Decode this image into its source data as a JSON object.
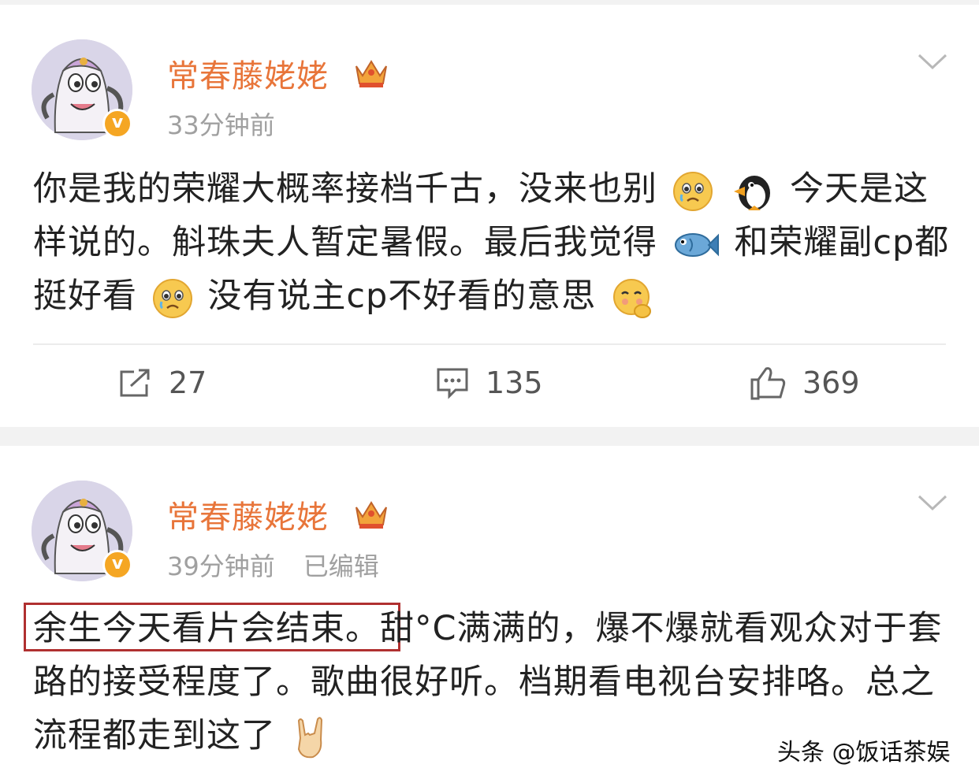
{
  "posts": [
    {
      "username": "常春藤姥姥",
      "time": "33分钟前",
      "edited": "",
      "text": {
        "part1": "你是我的荣耀大概率接档千古，没来也别",
        "part2": "今天是这样说的。斛珠夫人暂定暑假。最后我觉得",
        "part3": "和荣耀副cp都挺好看",
        "part4": "没有说主cp不好看的意思"
      },
      "actions": {
        "repost": "27",
        "comment": "135",
        "like": "369"
      }
    },
    {
      "username": "常春藤姥姥",
      "time": "39分钟前",
      "edited": "已编辑",
      "text": {
        "highlight": "余生今天看片会结束。",
        "part1": "甜°C满满的，爆不爆就看观众对于套路的接受程度了。歌曲很好听。档期看电视台安排咯。总之流程都走到这了"
      }
    }
  ],
  "icons": {
    "avatar": "teapot-avatar",
    "verified": "verified-badge",
    "crown": "crown-icon",
    "chevron": "chevron-down-icon"
  },
  "colors": {
    "username": "#e8753a",
    "highlight_border": "#b03030",
    "verified": "#f5a623"
  },
  "watermark": "头条 @饭话茶娱"
}
